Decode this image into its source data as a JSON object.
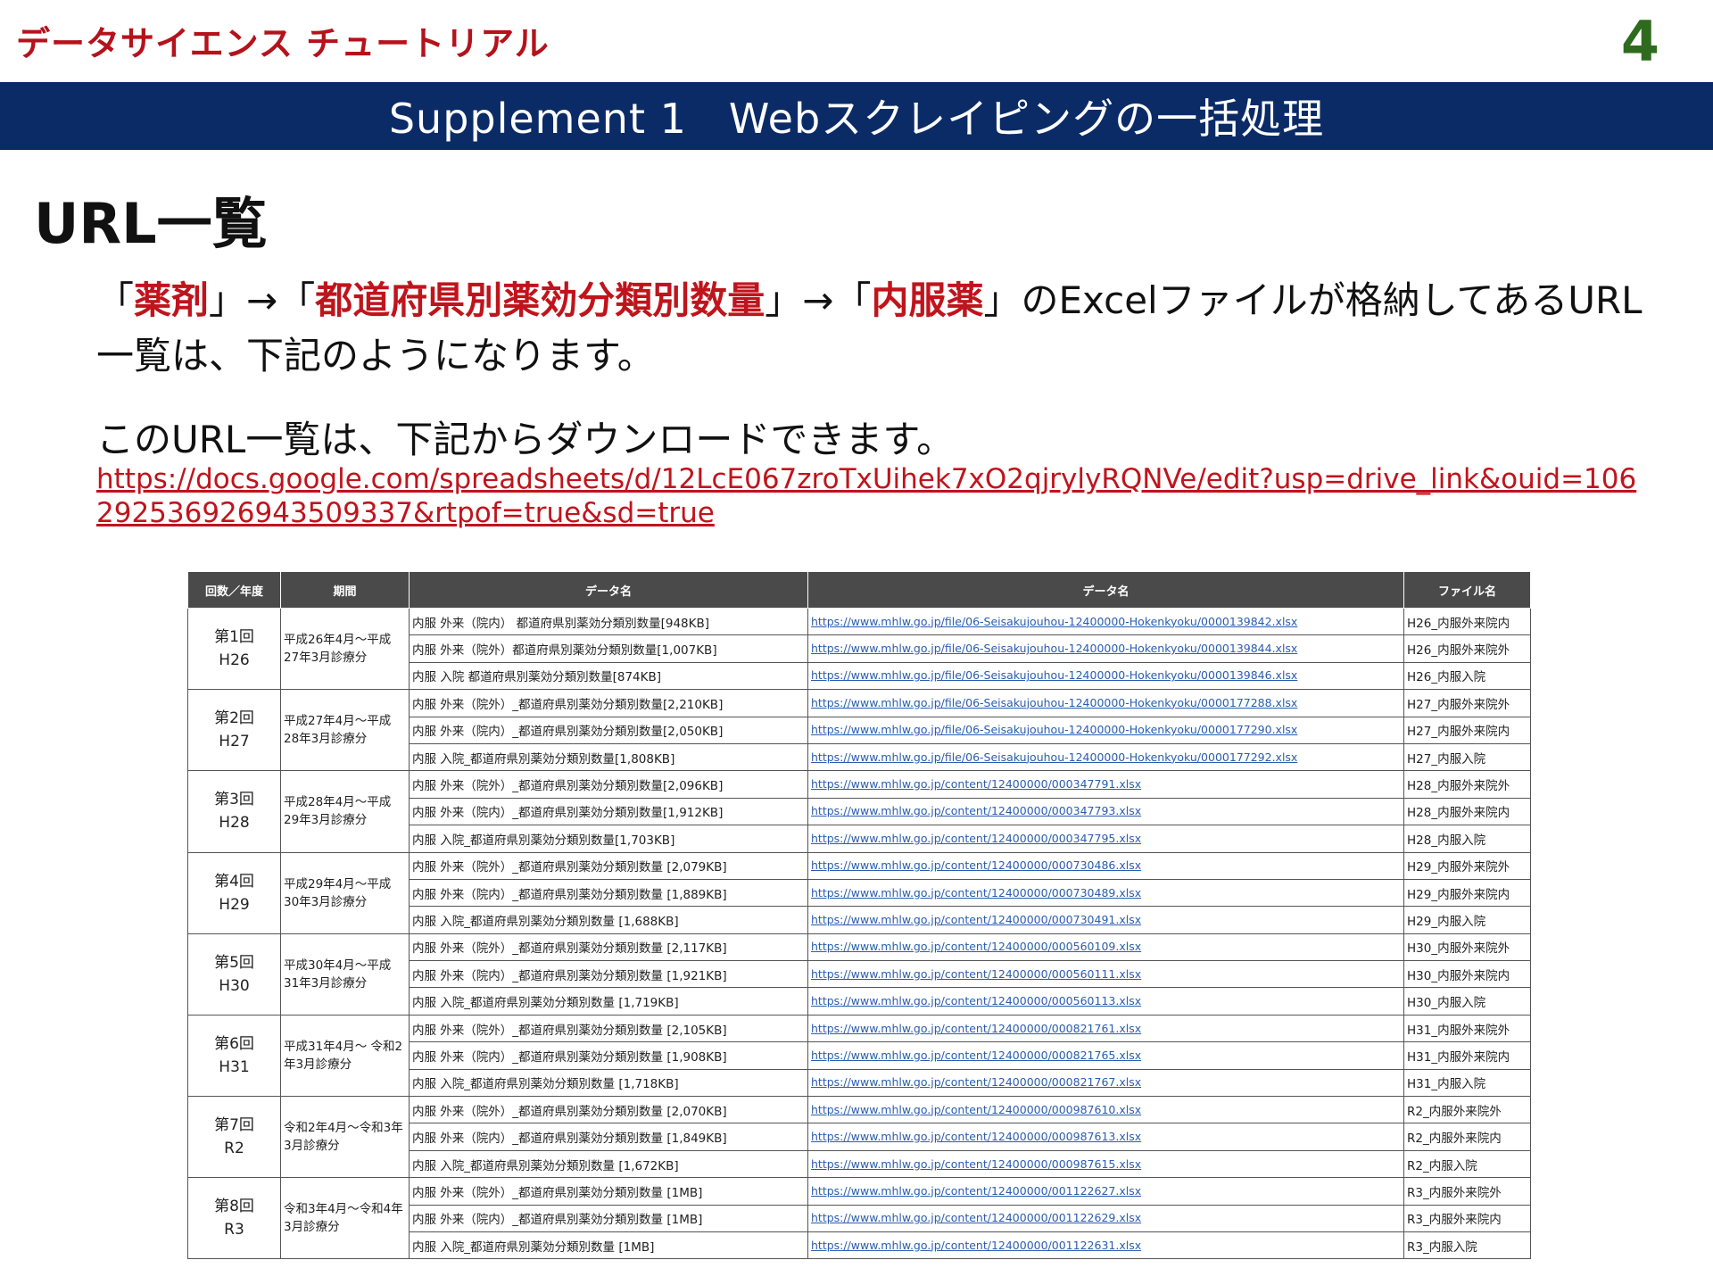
{
  "brand": "データサイエンス チュートリアル",
  "page_number": "4",
  "banner_title": "Supplement 1　Webスクレイピングの一括処理",
  "section_title": "URL一覧",
  "intro": {
    "q1_open": "「",
    "q1_hl": "薬剤",
    "q1_close": "」→「",
    "q2_hl": "都道府県別薬効分類別数量",
    "q2_close": "」→「",
    "q3_hl": "内服薬",
    "rest": "」のExcelファイルが格納してあるURL一覧は、下記のようになります。"
  },
  "download_text": "このURL一覧は、下記からダウンロードできます。",
  "download_link": "https://docs.google.com/spreadsheets/d/12LcE067zroTxUihek7xO2qjrylyRQNVe/edit?usp=drive_link&ouid=106292536926943509337&rtpof=true&sd=true",
  "table": {
    "headers": [
      "回数／年度",
      "期間",
      "データ名",
      "データ名",
      "ファイル名"
    ],
    "groups": [
      {
        "round": "第1回",
        "year": "H26",
        "period": "平成26年4月～平成27年3月診療分",
        "rows": [
          {
            "name": "内服 外来（院内） 都道府県別薬効分類別数量[948KB]",
            "url": "https://www.mhlw.go.jp/file/06-Seisakujouhou-12400000-Hokenkyoku/0000139842.xlsx",
            "file": "H26_内服外来院内"
          },
          {
            "name": "内服 外来（院外）都道府県別薬効分類別数量[1,007KB]",
            "url": "https://www.mhlw.go.jp/file/06-Seisakujouhou-12400000-Hokenkyoku/0000139844.xlsx",
            "file": "H26_内服外来院外"
          },
          {
            "name": "内服 入院 都道府県別薬効分類別数量[874KB]",
            "url": "https://www.mhlw.go.jp/file/06-Seisakujouhou-12400000-Hokenkyoku/0000139846.xlsx",
            "file": "H26_内服入院"
          }
        ]
      },
      {
        "round": "第2回",
        "year": "H27",
        "period": "平成27年4月～平成28年3月診療分",
        "rows": [
          {
            "name": "内服 外来（院外）_都道府県別薬効分類別数量[2,210KB]",
            "url": "https://www.mhlw.go.jp/file/06-Seisakujouhou-12400000-Hokenkyoku/0000177288.xlsx",
            "file": "H27_内服外来院外"
          },
          {
            "name": "内服 外来（院内）_都道府県別薬効分類別数量[2,050KB]",
            "url": "https://www.mhlw.go.jp/file/06-Seisakujouhou-12400000-Hokenkyoku/0000177290.xlsx",
            "file": "H27_内服外来院内"
          },
          {
            "name": "内服 入院_都道府県別薬効分類別数量[1,808KB]",
            "url": "https://www.mhlw.go.jp/file/06-Seisakujouhou-12400000-Hokenkyoku/0000177292.xlsx",
            "file": "H27_内服入院"
          }
        ]
      },
      {
        "round": "第3回",
        "year": "H28",
        "period": "平成28年4月～平成29年3月診療分",
        "rows": [
          {
            "name": "内服 外来（院外）_都道府県別薬効分類別数量[2,096KB]",
            "url": "https://www.mhlw.go.jp/content/12400000/000347791.xlsx",
            "file": "H28_内服外来院外"
          },
          {
            "name": "内服 外来（院内）_都道府県別薬効分類別数量[1,912KB]",
            "url": "https://www.mhlw.go.jp/content/12400000/000347793.xlsx",
            "file": "H28_内服外来院内"
          },
          {
            "name": "内服 入院_都道府県別薬効分類別数量[1,703KB]",
            "url": "https://www.mhlw.go.jp/content/12400000/000347795.xlsx",
            "file": "H28_内服入院"
          }
        ]
      },
      {
        "round": "第4回",
        "year": "H29",
        "period": "平成29年4月～平成30年3月診療分",
        "rows": [
          {
            "name": "内服 外来（院外）_都道府県別薬効分類別数量 [2,079KB]",
            "url": "https://www.mhlw.go.jp/content/12400000/000730486.xlsx",
            "file": "H29_内服外来院外"
          },
          {
            "name": "内服 外来（院内）_都道府県別薬効分類別数量 [1,889KB]",
            "url": "https://www.mhlw.go.jp/content/12400000/000730489.xlsx",
            "file": "H29_内服外来院内"
          },
          {
            "name": "内服 入院_都道府県別薬効分類別数量 [1,688KB]",
            "url": "https://www.mhlw.go.jp/content/12400000/000730491.xlsx",
            "file": "H29_内服入院"
          }
        ]
      },
      {
        "round": "第5回",
        "year": "H30",
        "period": "平成30年4月～平成31年3月診療分",
        "rows": [
          {
            "name": "内服 外来（院外）_都道府県別薬効分類別数量 [2,117KB]",
            "url": "https://www.mhlw.go.jp/content/12400000/000560109.xlsx",
            "file": "H30_内服外来院外"
          },
          {
            "name": "内服 外来（院内）_都道府県別薬効分類別数量 [1,921KB]",
            "url": "https://www.mhlw.go.jp/content/12400000/000560111.xlsx",
            "file": "H30_内服外来院内"
          },
          {
            "name": "内服 入院_都道府県別薬効分類別数量 [1,719KB]",
            "url": "https://www.mhlw.go.jp/content/12400000/000560113.xlsx",
            "file": "H30_内服入院"
          }
        ]
      },
      {
        "round": "第6回",
        "year": "H31",
        "period": "平成31年4月～ 令和2年3月診療分",
        "rows": [
          {
            "name": "内服 外来（院外）_都道府県別薬効分類別数量 [2,105KB]",
            "url": "https://www.mhlw.go.jp/content/12400000/000821761.xlsx",
            "file": "H31_内服外来院外"
          },
          {
            "name": "内服 外来（院内）_都道府県別薬効分類別数量 [1,908KB]",
            "url": "https://www.mhlw.go.jp/content/12400000/000821765.xlsx",
            "file": "H31_内服外来院内"
          },
          {
            "name": "内服 入院_都道府県別薬効分類別数量 [1,718KB]",
            "url": "https://www.mhlw.go.jp/content/12400000/000821767.xlsx",
            "file": "H31_内服入院"
          }
        ]
      },
      {
        "round": "第7回",
        "year": "R2",
        "period": "令和2年4月～令和3年3月診療分",
        "rows": [
          {
            "name": "内服 外来（院外）_都道府県別薬効分類別数量 [2,070KB]",
            "url": "https://www.mhlw.go.jp/content/12400000/000987610.xlsx",
            "file": "R2_内服外来院外"
          },
          {
            "name": "内服 外来（院内）_都道府県別薬効分類別数量 [1,849KB]",
            "url": "https://www.mhlw.go.jp/content/12400000/000987613.xlsx",
            "file": "R2_内服外来院内"
          },
          {
            "name": "内服 入院_都道府県別薬効分類別数量 [1,672KB]",
            "url": "https://www.mhlw.go.jp/content/12400000/000987615.xlsx",
            "file": "R2_内服入院"
          }
        ]
      },
      {
        "round": "第8回",
        "year": "R3",
        "period": "令和3年4月～令和4年3月診療分",
        "rows": [
          {
            "name": "内服 外来（院外）_都道府県別薬効分類別数量 [1MB]",
            "url": "https://www.mhlw.go.jp/content/12400000/001122627.xlsx",
            "file": "R3_内服外来院外"
          },
          {
            "name": "内服 外来（院内）_都道府県別薬効分類別数量 [1MB]",
            "url": "https://www.mhlw.go.jp/content/12400000/001122629.xlsx",
            "file": "R3_内服外来院内"
          },
          {
            "name": "内服 入院_都道府県別薬効分類別数量 [1MB]",
            "url": "https://www.mhlw.go.jp/content/12400000/001122631.xlsx",
            "file": "R3_内服入院"
          }
        ]
      }
    ]
  }
}
